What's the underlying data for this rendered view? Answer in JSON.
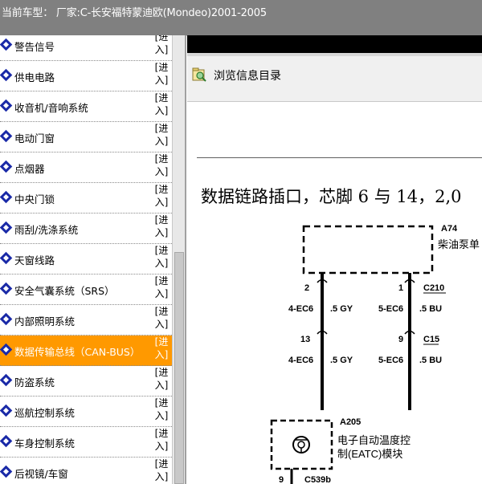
{
  "title_bar": {
    "text": "当前车型： 厂家:C-长安福特蒙迪欧(Mondeo)2001-2005"
  },
  "sidebar": {
    "items": [
      {
        "label": "警告信号",
        "enter": "[进入]"
      },
      {
        "label": "供电电路",
        "enter": "[进入]"
      },
      {
        "label": "收音机/音响系统",
        "enter": "[进入]"
      },
      {
        "label": "电动门窗",
        "enter": "[进入]"
      },
      {
        "label": "点烟器",
        "enter": "[进入]"
      },
      {
        "label": "中央门锁",
        "enter": "[进入]"
      },
      {
        "label": "雨刮/洗涤系统",
        "enter": "[进入]"
      },
      {
        "label": "天窗线路",
        "enter": "[进入]"
      },
      {
        "label": "安全气囊系统（SRS）",
        "enter": "[进入]"
      },
      {
        "label": "内部照明系统",
        "enter": "[进入]"
      },
      {
        "label": "数据传输总线（CAN-BUS）",
        "enter": "[进入]",
        "selected": true
      },
      {
        "label": "防盗系统",
        "enter": "[进入]"
      },
      {
        "label": "巡航控制系统",
        "enter": "[进入]"
      },
      {
        "label": "车身控制系统",
        "enter": "[进入]"
      },
      {
        "label": "后视镜/车窗",
        "enter": "[进入]"
      }
    ],
    "selected_color": "#ff9900"
  },
  "toolbar": {
    "browse_label": "浏览信息目录"
  },
  "document": {
    "heading": "数据链路插口，芯脚 6 与 14，2,0",
    "diagram": {
      "a74_code": "A74",
      "a74_name": "柴油泵单",
      "pin_2": "2",
      "pin_1": "1",
      "c210": "C210",
      "wire_left_top": "4-EC6",
      "size_left_top": ".5 GY",
      "wire_right_top": "5-EC6",
      "size_right_top": ".5 BU",
      "pin_13": "13",
      "pin_9": "9",
      "c15": "C15",
      "wire_left_bot": "4-EC6",
      "size_left_bot": ".5 GY",
      "wire_right_bot": "5-EC6",
      "size_right_bot": ".5 BU",
      "a205_code": "A205",
      "a205_name_1": "电子自动温度控",
      "a205_name_2": "制(EATC)模块",
      "pin_9b": "9",
      "c539b": "C539b"
    }
  }
}
